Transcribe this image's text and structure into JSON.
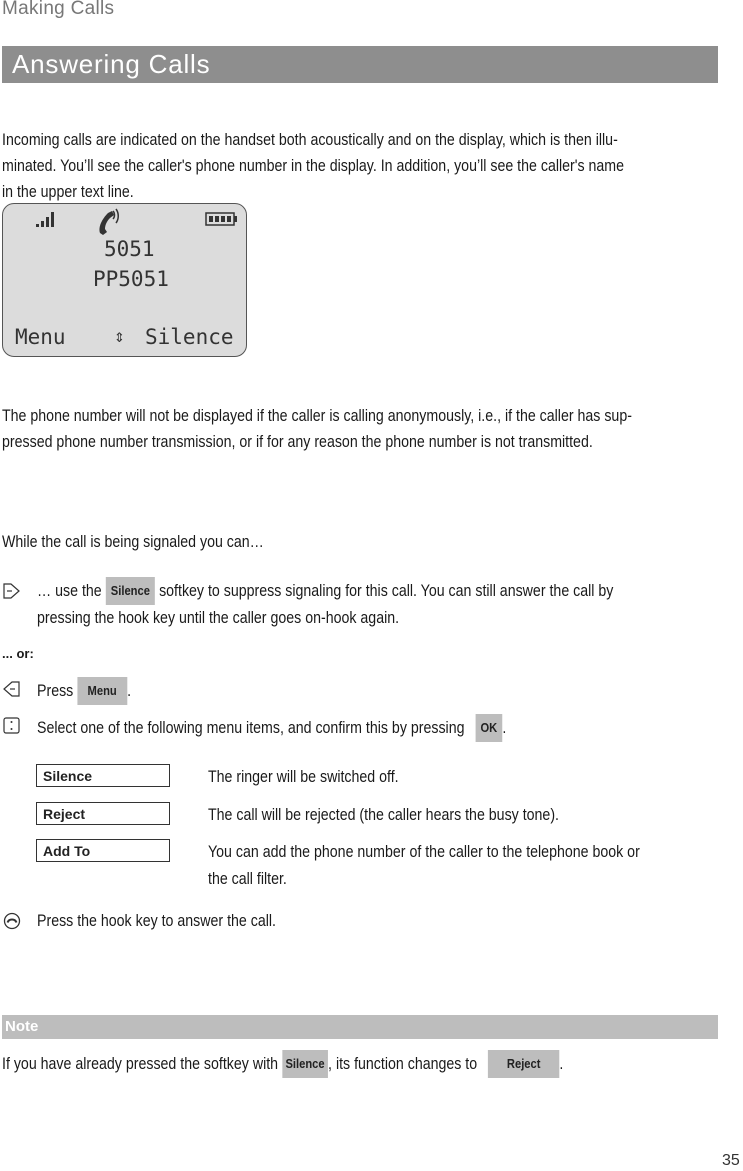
{
  "running_head": "Making Calls",
  "section_title": "Answering Calls",
  "intro": {
    "line1": "Incoming calls are indicated on the handset both acoustically and on the display, which is then illu-",
    "line2": "minated. You’ll see the caller's phone number in the display. In addition, you’ll see the caller's name",
    "line3": "in the upper text line."
  },
  "display": {
    "icons": [
      "signal-strength-icon",
      "ringing-handset-icon",
      "battery-icon"
    ],
    "number": "5051",
    "name": "PP5051",
    "left_softkey": "Menu",
    "nav_symbol": "⇕",
    "right_softkey": "Silence"
  },
  "anon": {
    "line1": "The phone number will not be displayed if the caller is calling anonymously, i.e., if the caller has sup-",
    "line2": "pressed phone number transmission, or if for any reason the phone number is not transmitted."
  },
  "while_signaled": "While the call is being signaled you can…",
  "step1": {
    "prefix": "… use the",
    "key": "Silence",
    "suffix": "softkey to suppress signaling for this call. You can still answer the call by",
    "line2": "pressing the hook key until the caller goes on-hook again."
  },
  "or_label": "... or:",
  "step2": {
    "prefix": "Press",
    "key": "Menu",
    "suffix": "."
  },
  "step3": {
    "prefix": "Select one of the following menu items, and confirm this by pressing",
    "key": "OK",
    "suffix": "."
  },
  "options": [
    {
      "label": "Silence",
      "desc": "The ringer will be switched off."
    },
    {
      "label": "Reject",
      "desc": "The call will be rejected (the caller hears the busy tone)."
    },
    {
      "label": "Add To",
      "desc": "You can add the phone number of the caller to the telephone book or",
      "desc2": "the call filter."
    }
  ],
  "step4": "Press the hook key to answer the call.",
  "note": {
    "title": "Note",
    "prefix": "If you have already pressed the softkey with",
    "key1": "Silence",
    "middle": ", its function changes to",
    "key2": "Reject",
    "suffix": "."
  },
  "page_number": "35"
}
